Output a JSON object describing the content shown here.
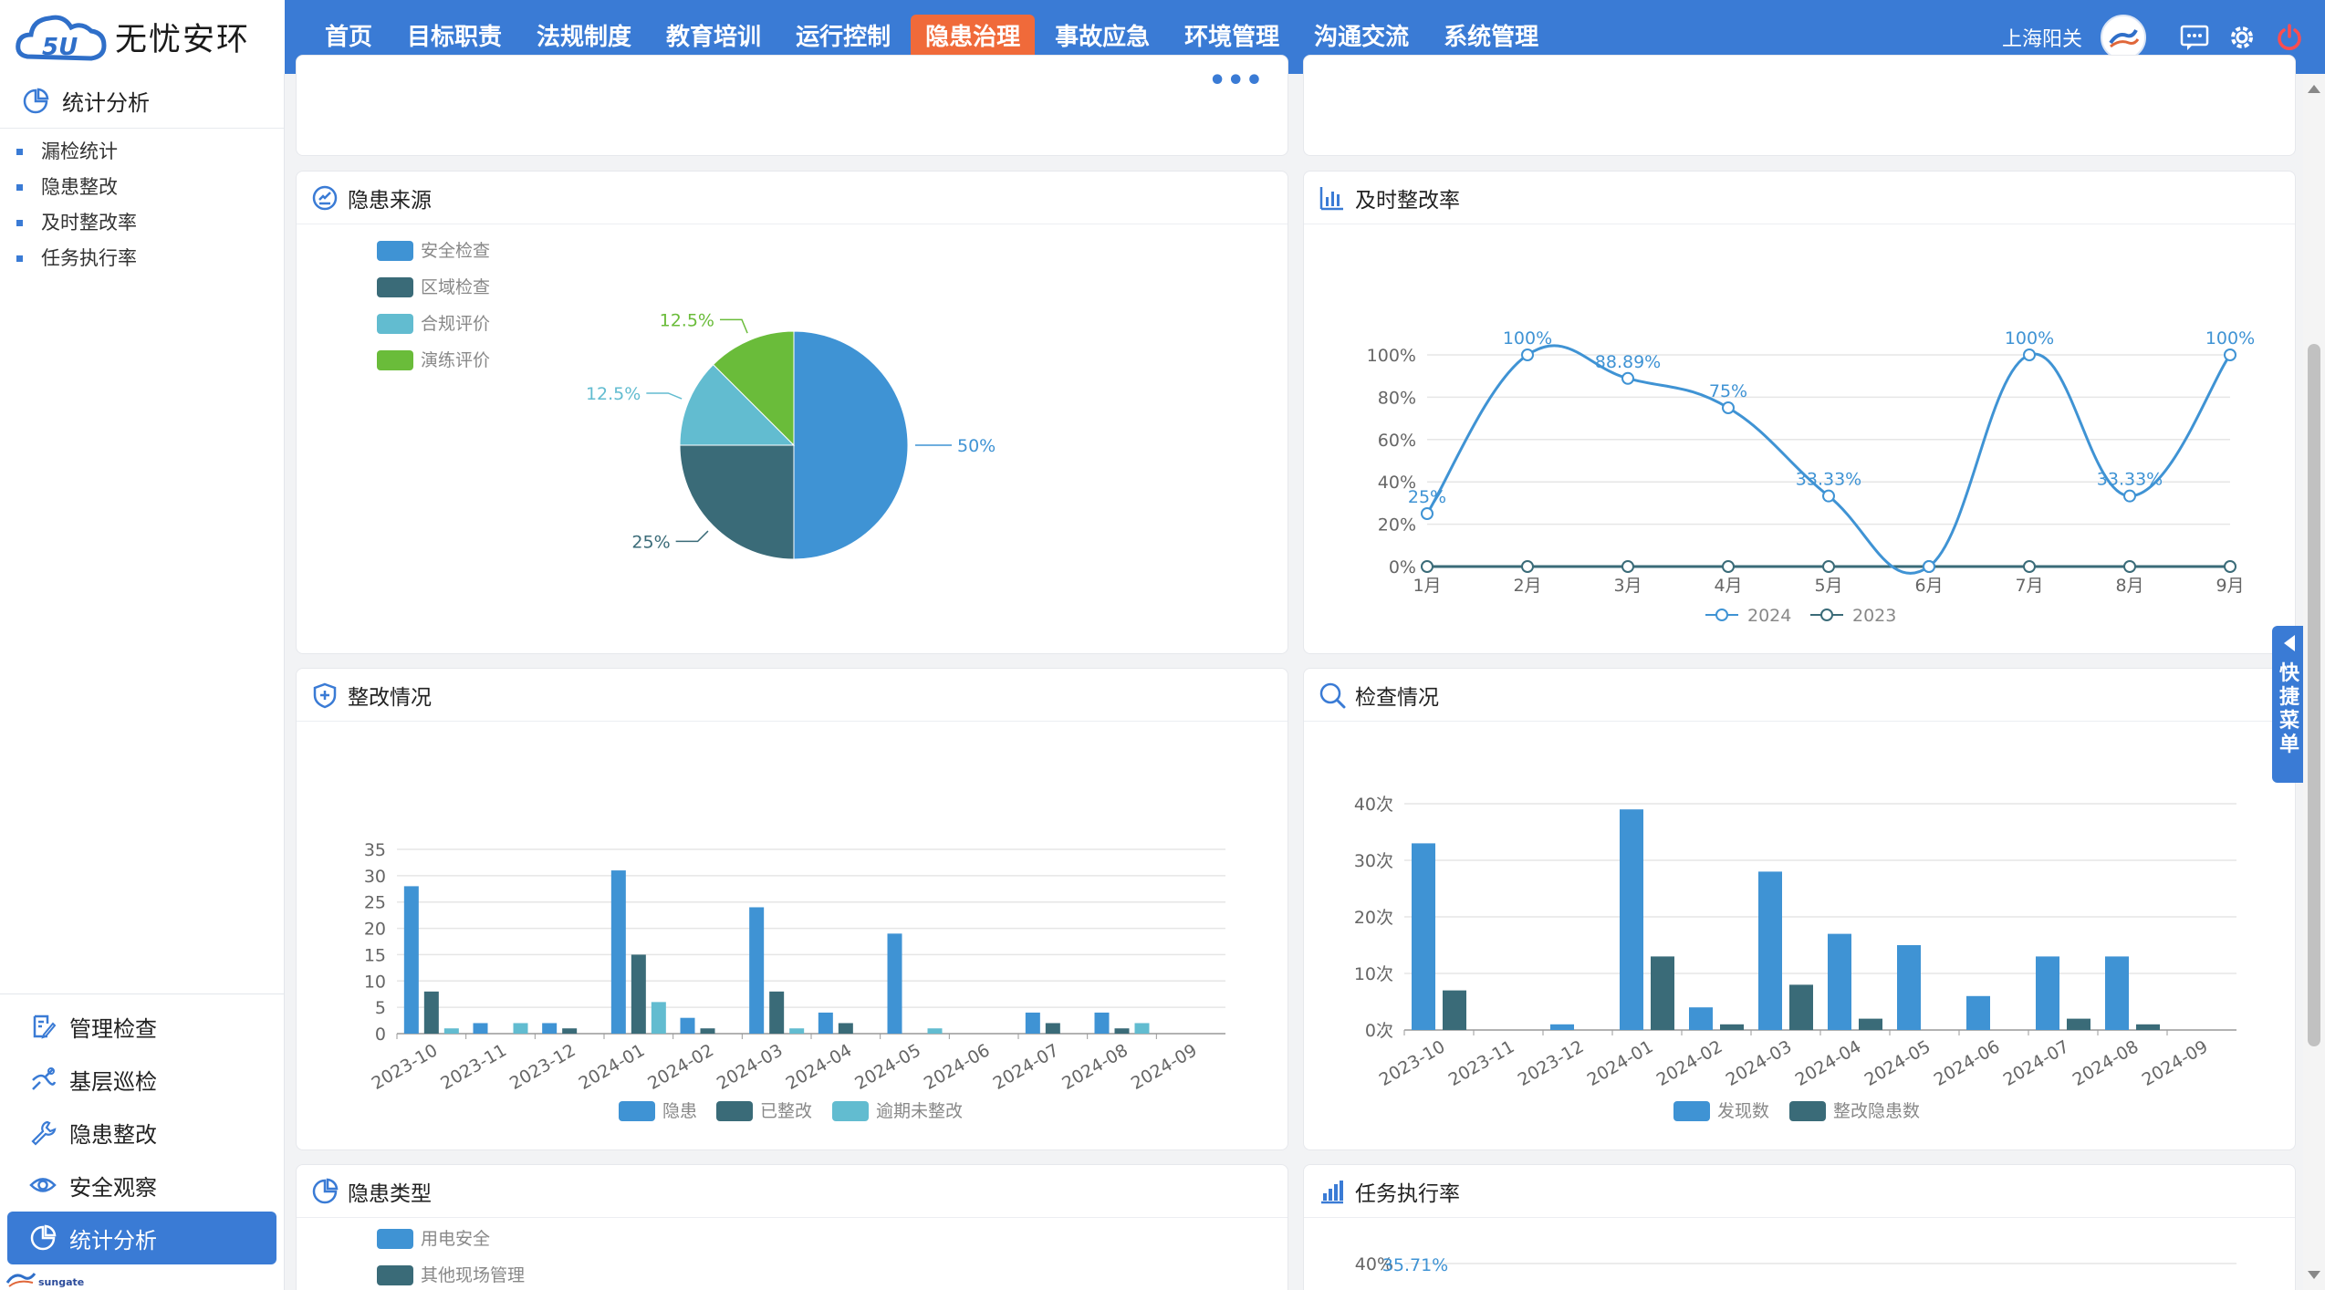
{
  "app": {
    "logo_text": "无忧安环",
    "logo_badge": "5U",
    "nav": [
      "首页",
      "目标职责",
      "法规制度",
      "教育培训",
      "运行控制",
      "隐患治理",
      "事故应急",
      "环境管理",
      "沟通交流",
      "系统管理"
    ],
    "nav_active": "隐患治理",
    "user_name": "上海阳关",
    "icons": {
      "message": "message-icon",
      "settings": "gear-icon",
      "power": "power-icon"
    },
    "accent": "#3a7bd5",
    "active_nav_color": "#f06a3a"
  },
  "sidebar": {
    "section_title": "统计分析",
    "sub_items": [
      "漏检统计",
      "隐患整改",
      "及时整改率",
      "任务执行率"
    ],
    "bottom_items": [
      {
        "label": "管理检查",
        "icon": "edit-doc-icon"
      },
      {
        "label": "基层巡检",
        "icon": "route-icon"
      },
      {
        "label": "隐患整改",
        "icon": "wrench-icon"
      },
      {
        "label": "安全观察",
        "icon": "eye-icon"
      },
      {
        "label": "统计分析",
        "icon": "pie-chart-icon"
      }
    ],
    "bottom_active": "统计分析",
    "brand_footer": "sungate"
  },
  "quick_menu": {
    "label": "快捷菜单"
  },
  "cards": {
    "source_title": "隐患来源",
    "rate_title": "及时整改率",
    "rectify_title": "整改情况",
    "inspect_title": "检查情况",
    "type_title": "隐患类型",
    "task_title": "任务执行率"
  },
  "chart_data": [
    {
      "id": "hazard-source",
      "type": "pie",
      "title": "隐患来源",
      "legend": [
        "安全检查",
        "区域检查",
        "合规评价",
        "演练评价"
      ],
      "values": [
        50,
        25,
        12.5,
        12.5
      ],
      "labels": [
        "50%",
        "25%",
        "12.5%",
        "12.5%"
      ],
      "colors": [
        "#3f93d4",
        "#3a6b78",
        "#62bcd0",
        "#6abc3a"
      ],
      "legend_placement": "top-left"
    },
    {
      "id": "timely-rate",
      "type": "line",
      "title": "及时整改率",
      "categories": [
        "1月",
        "2月",
        "3月",
        "4月",
        "5月",
        "6月",
        "7月",
        "8月",
        "9月"
      ],
      "ylim": [
        0,
        100
      ],
      "yticks": [
        "0%",
        "20%",
        "40%",
        "60%",
        "80%",
        "100%"
      ],
      "series": [
        {
          "name": "2024",
          "values": [
            25,
            100,
            88.89,
            75,
            33.33,
            0,
            100,
            33.33,
            100
          ],
          "labels": [
            "25%",
            "100%",
            "88.89%",
            "75%",
            "33.33%",
            "",
            "100%",
            "33.33%",
            "100%"
          ],
          "color": "#3f93d4"
        },
        {
          "name": "2023",
          "values": [
            0,
            0,
            0,
            0,
            0,
            0,
            0,
            0,
            0
          ],
          "color": "#3a6b78"
        }
      ],
      "grid": true,
      "legend_placement": "bottom"
    },
    {
      "id": "rectify-status",
      "type": "bar",
      "title": "整改情况",
      "categories": [
        "2023-10",
        "2023-11",
        "2023-12",
        "2024-01",
        "2024-02",
        "2024-03",
        "2024-04",
        "2024-05",
        "2024-06",
        "2024-07",
        "2024-08",
        "2024-09"
      ],
      "ylim": [
        0,
        35
      ],
      "yticks": [
        "0",
        "5",
        "10",
        "15",
        "20",
        "25",
        "30",
        "35"
      ],
      "series": [
        {
          "name": "隐患",
          "values": [
            28,
            2,
            2,
            31,
            3,
            24,
            4,
            19,
            0,
            4,
            4,
            0
          ],
          "color": "#3f93d4"
        },
        {
          "name": "已整改",
          "values": [
            8,
            0,
            1,
            15,
            1,
            8,
            2,
            0,
            0,
            2,
            1,
            0
          ],
          "color": "#3a6b78"
        },
        {
          "name": "逾期未整改",
          "values": [
            1,
            2,
            0,
            6,
            0,
            1,
            0,
            1,
            0,
            0,
            2,
            0
          ],
          "color": "#62bcd0"
        }
      ],
      "grid": true,
      "legend_placement": "bottom"
    },
    {
      "id": "inspection-status",
      "type": "bar",
      "title": "检查情况",
      "categories": [
        "2023-10",
        "2023-11",
        "2023-12",
        "2024-01",
        "2024-02",
        "2024-03",
        "2024-04",
        "2024-05",
        "2024-06",
        "2024-07",
        "2024-08",
        "2024-09"
      ],
      "ylim": [
        0,
        40
      ],
      "yticks": [
        "0次",
        "10次",
        "20次",
        "30次",
        "40次"
      ],
      "series": [
        {
          "name": "发现数",
          "values": [
            33,
            0,
            1,
            39,
            4,
            28,
            17,
            15,
            6,
            13,
            13,
            0
          ],
          "color": "#3f93d4"
        },
        {
          "name": "整改隐患数",
          "values": [
            7,
            0,
            0,
            13,
            1,
            8,
            2,
            0,
            0,
            2,
            1,
            0
          ],
          "color": "#3a6b78"
        }
      ],
      "grid": true,
      "legend_placement": "bottom"
    },
    {
      "id": "hazard-type",
      "type": "pie",
      "title": "隐患类型",
      "legend": [
        "用电安全",
        "其他现场管理"
      ],
      "colors": [
        "#3f93d4",
        "#3a6b78"
      ],
      "legend_placement": "top-left"
    },
    {
      "id": "task-rate",
      "type": "line",
      "title": "任务执行率",
      "yticks": [
        "40%"
      ],
      "series": [
        {
          "name": "",
          "labels": [
            "35.71%"
          ],
          "color": "#3f93d4"
        }
      ]
    }
  ]
}
